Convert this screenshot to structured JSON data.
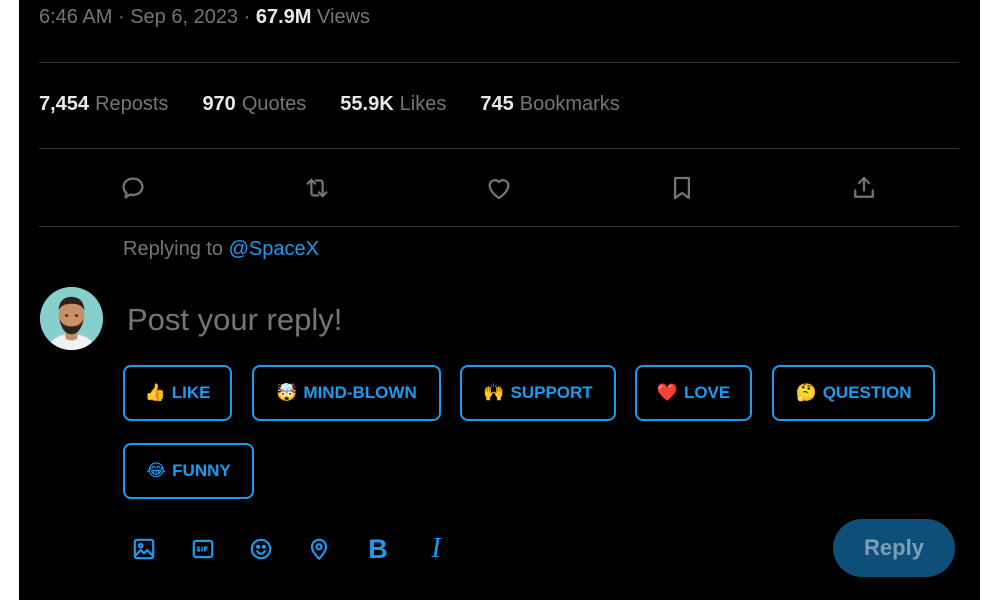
{
  "tweet_meta": {
    "time": "6:46 AM",
    "separator": "·",
    "date": "Sep 6, 2023",
    "views_count": "67.9M",
    "views_label": "Views"
  },
  "stats": [
    {
      "count": "7,454",
      "label": "Reposts"
    },
    {
      "count": "970",
      "label": "Quotes"
    },
    {
      "count": "55.9K",
      "label": "Likes"
    },
    {
      "count": "745",
      "label": "Bookmarks"
    }
  ],
  "actions": [
    "reply-icon",
    "repost-icon",
    "like-icon",
    "bookmark-icon",
    "share-icon"
  ],
  "replying": {
    "prefix": "Replying to",
    "handle": "@SpaceX"
  },
  "composer": {
    "placeholder": "Post your reply!",
    "value": ""
  },
  "reactions": [
    {
      "emoji": "👍",
      "label": "LIKE"
    },
    {
      "emoji": "🤯",
      "label": "MIND-BLOWN"
    },
    {
      "emoji": "🙌",
      "label": "SUPPORT"
    },
    {
      "emoji": "❤️",
      "label": "LOVE"
    },
    {
      "emoji": "🤔",
      "label": "QUESTION"
    },
    {
      "emoji": "😂",
      "label": "FUNNY"
    }
  ],
  "toolbar": {
    "icons": [
      "image-icon",
      "gif-icon",
      "emoji-icon",
      "location-icon"
    ],
    "bold_label": "B",
    "italic_label": "I"
  },
  "reply_button": {
    "label": "Reply"
  },
  "colors": {
    "accent": "#1d9bf0",
    "background": "#000000",
    "muted_text": "#71767b",
    "primary_text": "#e7e9ea",
    "disabled_button": "#0e4f7a"
  }
}
